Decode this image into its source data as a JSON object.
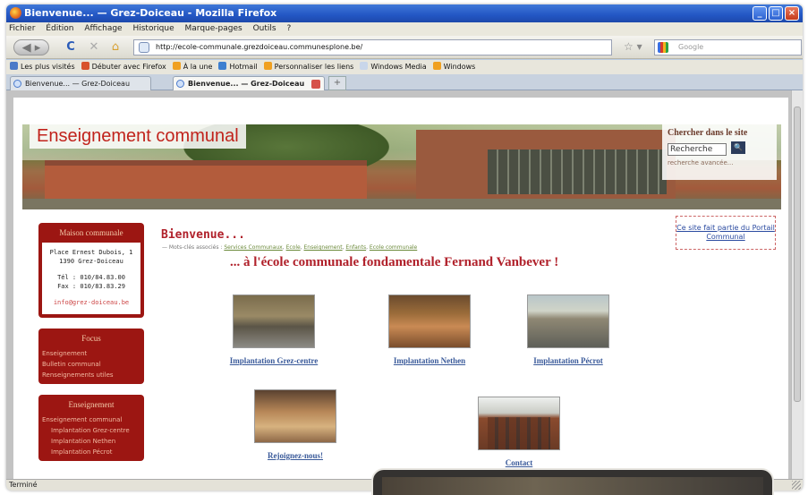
{
  "window": {
    "title": "Bienvenue... — Grez-Doiceau - Mozilla Firefox",
    "controls": {
      "minimize": "_",
      "maximize": "□",
      "close": "×"
    }
  },
  "menubar": [
    "Fichier",
    "Édition",
    "Affichage",
    "Historique",
    "Marque-pages",
    "Outils",
    "?"
  ],
  "navbar": {
    "back": "◀ ▸",
    "reload": "C",
    "stop": "✕",
    "home": "⌂",
    "url": "http://ecole-communale.grezdoiceau.communesplone.be/",
    "search_placeholder": "Google"
  },
  "bookmarks": [
    {
      "label": "Les plus visités",
      "color": "#4a79c8"
    },
    {
      "label": "Débuter avec Firefox",
      "color": "#d8522a"
    },
    {
      "label": "À la une",
      "color": "#f0a020"
    },
    {
      "label": "Hotmail",
      "color": "#3d7fd0"
    },
    {
      "label": "Personnaliser les liens",
      "color": "#f0a020"
    },
    {
      "label": "Windows Media",
      "color": "#c9d6ea"
    },
    {
      "label": "Windows",
      "color": "#f0a020"
    }
  ],
  "tabs": [
    {
      "label": "Bienvenue... — Grez-Doiceau"
    },
    {
      "label": "Bienvenue... — Grez-Doiceau"
    }
  ],
  "page": {
    "banner_title": "Enseignement communal",
    "search": {
      "label": "Chercher dans le site",
      "value": "Recherche",
      "advanced": "recherche avancée..."
    },
    "portal_link": "Ce site fait partie du Portail Communal",
    "sidebar": {
      "contact_head": "Maison communale",
      "address1": "Place Ernest Dubois, 1",
      "address2": "1390 Grez-Doiceau",
      "tel": "Tél : 010/84.83.00",
      "fax": "Fax : 010/83.83.29",
      "email": "info@grez-doiceau.be",
      "focus_head": "Focus",
      "focus_items": [
        "Enseignement",
        "Bulletin communal",
        "Renseignements utiles"
      ],
      "ens_head": "Enseignement",
      "ens_items": [
        {
          "label": "Enseignement communal",
          "sub": false
        },
        {
          "label": "Implantation Grez-centre",
          "sub": true
        },
        {
          "label": "Implantation Nethen",
          "sub": true
        },
        {
          "label": "Implantation Pécrot",
          "sub": true
        }
      ]
    },
    "heading": "Bienvenue...",
    "breadcrumb_prefix": "— Mots-clés associés :",
    "breadcrumb_links": [
      "Services Communaux",
      "Ecole",
      "Enseignement",
      "Enfants",
      "Ecole communale"
    ],
    "welcome": "... à l'école communale fondamentale Fernand Vanbever !",
    "tiles": [
      "Implantation Grez-centre",
      "Implantation Nethen",
      "Implantation Pécrot",
      "Rejoignez-nous!",
      "Contact"
    ]
  },
  "statusbar": "Terminé"
}
